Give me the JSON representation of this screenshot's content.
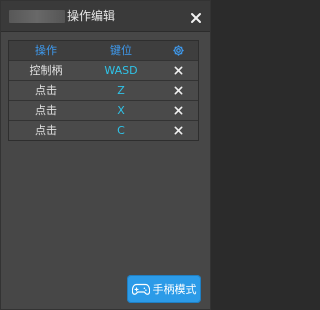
{
  "window": {
    "title": "操作编辑"
  },
  "table": {
    "headers": {
      "action": "操作",
      "key": "键位"
    },
    "rows": [
      {
        "action": "控制柄",
        "key": "WASD"
      },
      {
        "action": "点击",
        "key": "Z"
      },
      {
        "action": "点击",
        "key": "X"
      },
      {
        "action": "点击",
        "key": "C"
      }
    ]
  },
  "footer": {
    "gamepad_mode_label": "手柄模式"
  },
  "icons": {
    "close": "close-icon",
    "settings": "gear-icon",
    "delete": "close-icon",
    "gamepad": "gamepad-icon"
  },
  "colors": {
    "accent": "#2c9be8",
    "header_text": "#3e9bf0",
    "key_text": "#2fc3e8"
  }
}
